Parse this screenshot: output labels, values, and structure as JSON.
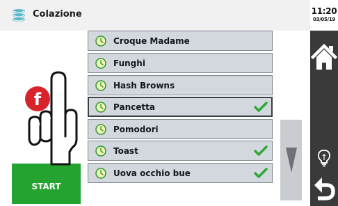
{
  "header": {
    "title": "Colazione",
    "icon": "stack-icon"
  },
  "clock": {
    "time": "11:20",
    "date": "03/05/19"
  },
  "menu": {
    "items": [
      {
        "label": "Croque Madame",
        "checked": false,
        "selected": false
      },
      {
        "label": "Funghi",
        "checked": false,
        "selected": false
      },
      {
        "label": "Hash Browns",
        "checked": false,
        "selected": false
      },
      {
        "label": "Pancetta",
        "checked": true,
        "selected": true
      },
      {
        "label": "Pomodori",
        "checked": false,
        "selected": false
      },
      {
        "label": "Toast",
        "checked": true,
        "selected": false
      },
      {
        "label": "Uova occhio bue",
        "checked": true,
        "selected": false
      }
    ]
  },
  "start_button": {
    "label": "START"
  },
  "hint": {
    "letter": "f"
  },
  "colors": {
    "accent_green": "#25a330",
    "check_green": "#2ea836",
    "item_bg": "#d3d7de",
    "sidebar_dark": "#3a3a3a",
    "hint_red": "#d8232a"
  }
}
